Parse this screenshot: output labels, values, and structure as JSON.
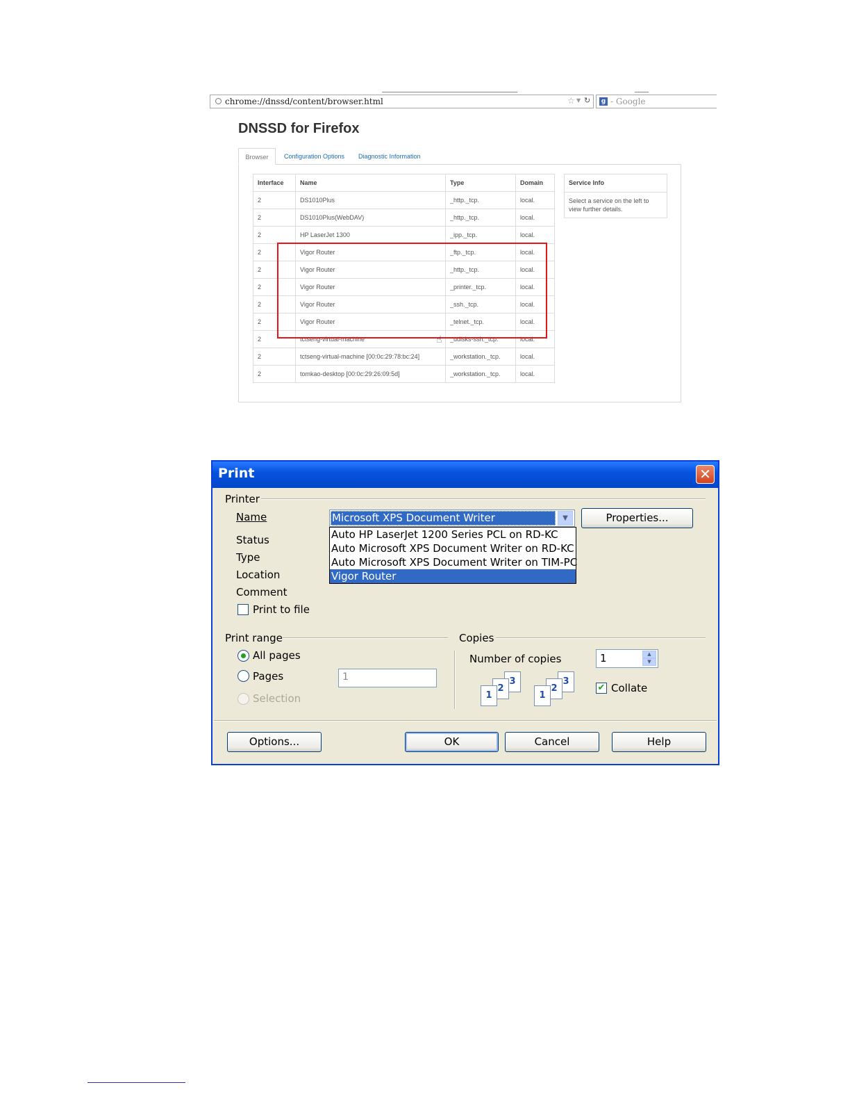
{
  "browser": {
    "url": "chrome://dnssd/content/browser.html",
    "search_placeholder": "Google",
    "page_title": "DNSSD for Firefox",
    "tabs": [
      {
        "label": "Browser",
        "active": true
      },
      {
        "label": "Configuration Options",
        "active": false
      },
      {
        "label": "Diagnostic Information",
        "active": false
      }
    ],
    "table": {
      "headers": [
        "Interface",
        "Name",
        "Type",
        "Domain"
      ],
      "rows": [
        [
          "2",
          "DS1010Plus",
          "_http._tcp.",
          "local."
        ],
        [
          "2",
          "DS1010Plus(WebDAV)",
          "_http._tcp.",
          "local."
        ],
        [
          "2",
          "HP LaserJet 1300",
          "_ipp._tcp.",
          "local."
        ],
        [
          "2",
          "Vigor Router",
          "_ftp._tcp.",
          "local."
        ],
        [
          "2",
          "Vigor Router",
          "_http._tcp.",
          "local."
        ],
        [
          "2",
          "Vigor Router",
          "_printer._tcp.",
          "local."
        ],
        [
          "2",
          "Vigor Router",
          "_ssh._tcp.",
          "local."
        ],
        [
          "2",
          "Vigor Router",
          "_telnet._tcp.",
          "local."
        ],
        [
          "2",
          "tctseng-virtual-machine",
          "_udisks-ssh._tcp.",
          "local."
        ],
        [
          "2",
          "tctseng-virtual-machine [00:0c:29:78:bc:24]",
          "_workstation._tcp.",
          "local."
        ],
        [
          "2",
          "tomkao-desktop [00:0c:29:26:09:5d]",
          "_workstation._tcp.",
          "local."
        ]
      ]
    },
    "service_info": {
      "title": "Service Info",
      "text": "Select a service on the left to view further details."
    },
    "highlight_color": "#e8141c"
  },
  "print_dialog": {
    "title": "Print",
    "printer_group": "Printer",
    "name_label": "Name",
    "selected_printer": "Microsoft XPS Document Writer",
    "printer_options": [
      "Auto HP LaserJet 1200 Series PCL on RD-KC",
      "Auto Microsoft XPS Document Writer on RD-KC",
      "Auto Microsoft XPS Document Writer on TIM-PC",
      "Vigor Router"
    ],
    "highlighted_option": "Vigor Router",
    "properties_button": "Properties...",
    "status_label": "Status",
    "type_label": "Type",
    "location_label": "Location",
    "comment_label": "Comment",
    "print_to_file_label": "Print to file",
    "print_to_file_checked": false,
    "print_range_group": "Print range",
    "all_pages_label": "All pages",
    "pages_label": "Pages",
    "selection_label": "Selection",
    "pages_value": "1",
    "copies_group": "Copies",
    "number_of_copies_label": "Number of copies",
    "copies_value": "1",
    "collate_label": "Collate",
    "collate_checked": true,
    "collate_icon_numbers": [
      "1",
      "2",
      "3"
    ],
    "options_button": "Options...",
    "ok_button": "OK",
    "cancel_button": "Cancel",
    "help_button": "Help",
    "accent_color": "#316ac5",
    "titlebar_color": "#0653e0"
  }
}
